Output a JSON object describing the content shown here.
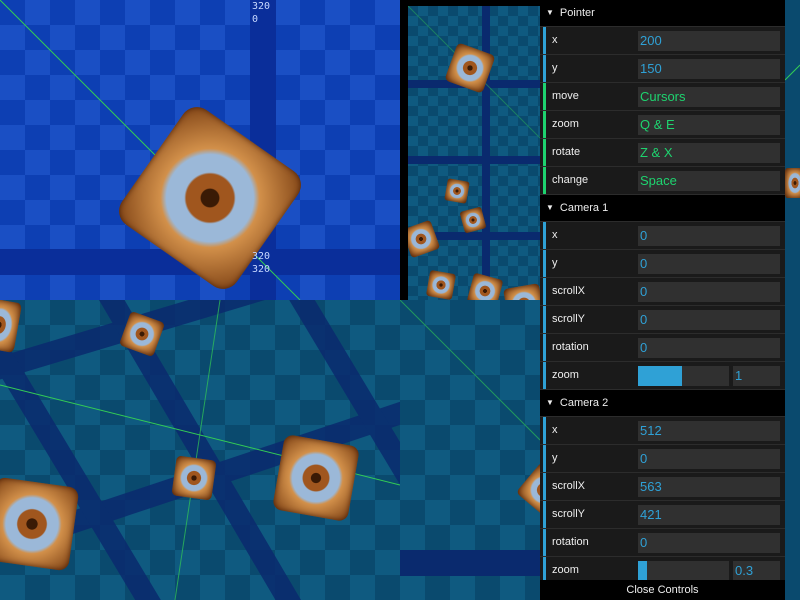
{
  "viewport1": {
    "labels": {
      "top_a": "320",
      "top_b": "0",
      "bottom_a": "320",
      "bottom_b": "320"
    }
  },
  "panel": {
    "pointer": {
      "title": "Pointer",
      "rows": [
        {
          "label": "x",
          "value": "200",
          "kind": "number"
        },
        {
          "label": "y",
          "value": "150",
          "kind": "number"
        },
        {
          "label": "move",
          "value": "Cursors",
          "kind": "string"
        },
        {
          "label": "zoom",
          "value": "Q & E",
          "kind": "string"
        },
        {
          "label": "rotate",
          "value": "Z & X",
          "kind": "string"
        },
        {
          "label": "change",
          "value": "Space",
          "kind": "string"
        }
      ]
    },
    "camera1": {
      "title": "Camera 1",
      "rows": [
        {
          "label": "x",
          "value": "0"
        },
        {
          "label": "y",
          "value": "0"
        },
        {
          "label": "scrollX",
          "value": "0"
        },
        {
          "label": "scrollY",
          "value": "0"
        },
        {
          "label": "rotation",
          "value": "0"
        }
      ],
      "zoom": {
        "label": "zoom",
        "value": "1",
        "fill": 0.48
      }
    },
    "camera2": {
      "title": "Camera 2",
      "rows": [
        {
          "label": "x",
          "value": "512"
        },
        {
          "label": "y",
          "value": "0"
        },
        {
          "label": "scrollX",
          "value": "563"
        },
        {
          "label": "scrollY",
          "value": "421"
        },
        {
          "label": "rotation",
          "value": "0"
        }
      ],
      "zoom": {
        "label": "zoom",
        "value": "0.3",
        "fill": 0.1
      }
    },
    "close_label": "Close Controls",
    "colors": {
      "number_stripe": "#2fa1d6",
      "string_stripe": "#1ed36f"
    }
  }
}
